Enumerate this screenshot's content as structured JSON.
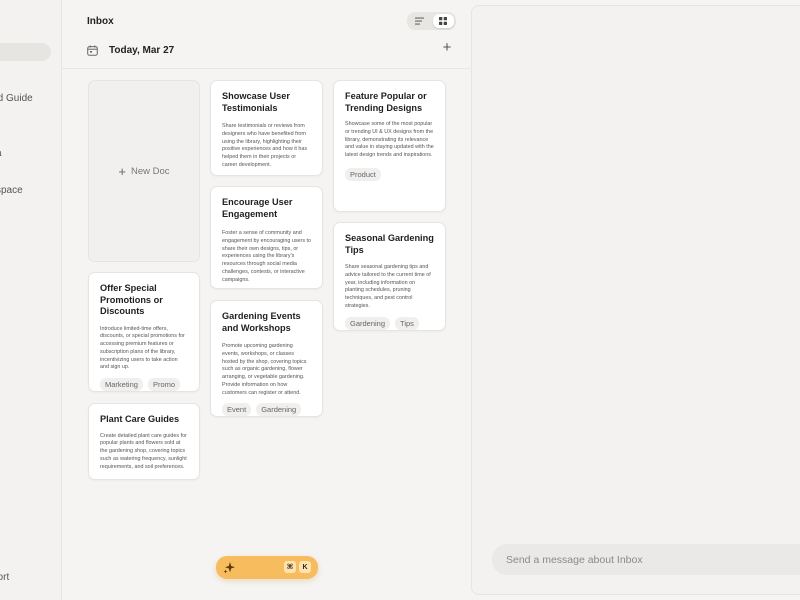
{
  "sidebar": {
    "items": [
      {
        "label": "rted Guide"
      },
      {
        "label": "a"
      },
      {
        "label": "space"
      },
      {
        "label": "port"
      }
    ]
  },
  "header": {
    "title": "Inbox",
    "view_icons": [
      "list-view-icon",
      "grid-view-icon"
    ],
    "active_view": "grid"
  },
  "date_group": {
    "label": "Today, Mar 27"
  },
  "new_doc": {
    "label": "New Doc"
  },
  "cards": [
    {
      "title": "Offer Special Promotions or Discounts",
      "description": "Introduce limited-time offers, discounts, or special promotions for accessing premium features or subscription plans of the library, incentivizing users to take action and sign up.",
      "tags": [
        "Marketing",
        "Promo"
      ]
    },
    {
      "title": "Plant Care Guides",
      "description": "Create detailed plant care guides for popular plants and flowers sold at the gardening shop, covering topics such as watering frequency, sunlight requirements, and soil preferences.",
      "tags": []
    },
    {
      "title": "Showcase User Testimonials",
      "description": "Share testimonials or reviews from designers who have benefited from using the library, highlighting their positive experiences and how it has helped them in their projects or career development.",
      "tags": []
    },
    {
      "title": "Encourage User Engagement",
      "description": "Foster a sense of community and engagement by encouraging users to share their own designs, tips, or experiences using the library's resources through social media challenges, contests, or interactive campaigns.",
      "tags": []
    },
    {
      "title": "Gardening Events and Workshops",
      "description": "Promote upcoming gardening events, workshops, or classes hosted by the shop, covering topics such as organic gardening, flower arranging, or vegetable gardening. Provide information on how customers can register or attend.",
      "tags": [
        "Event",
        "Gardening"
      ]
    },
    {
      "title": "Feature Popular or Trending Designs",
      "description": "Showcase some of the most popular or trending UI & UX designs from the library, demonstrating its relevance and value in staying updated with the latest design trends and inspirations.",
      "tags": [
        "Product"
      ]
    },
    {
      "title": "Seasonal Gardening Tips",
      "description": "Share seasonal gardening tips and advice tailored to the current time of year, including information on planting schedules, pruning techniques, and pest control strategies.",
      "tags": [
        "Gardening",
        "Tips"
      ]
    }
  ],
  "ai_button": {
    "icon": "sparkle-icon",
    "keys": [
      "⌘",
      "K"
    ],
    "color": "#f6bc5d"
  },
  "chat": {
    "placeholder": "Send a message about Inbox"
  }
}
